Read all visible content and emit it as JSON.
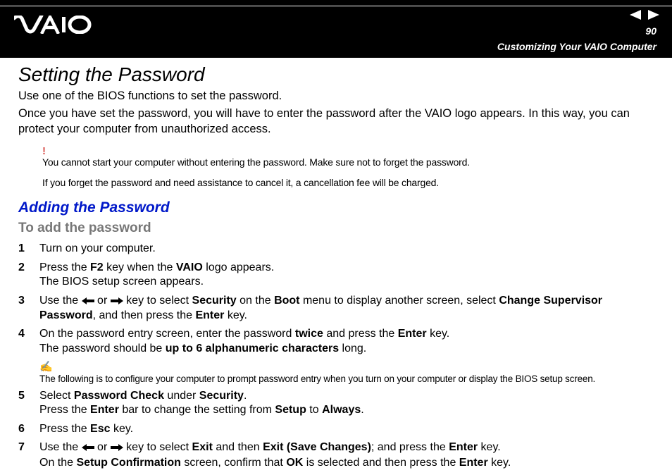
{
  "header": {
    "page_number": "90",
    "breadcrumb": "Customizing Your VAIO Computer"
  },
  "main": {
    "title": "Setting the Password",
    "intro1": "Use one of the BIOS functions to set the password.",
    "intro2": "Once you have set the password, you will have to enter the password after the VAIO logo appears. In this way, you can protect your computer from unauthorized access.",
    "warning_mark": "!",
    "warning_line1": "You cannot start your computer without entering the password. Make sure not to forget the password.",
    "warning_line2": "If you forget the password and need assistance to cancel it, a cancellation fee will be charged.",
    "subtitle": "Adding the Password",
    "subheading": "To add the password",
    "steps": {
      "s1": "Turn on your computer.",
      "s2_a": "Press the ",
      "s2_key": "F2",
      "s2_b": " key when the ",
      "s2_logo": "VAIO",
      "s2_c": " logo appears.",
      "s2_d": "The BIOS setup screen appears.",
      "s3_a": "Use the ",
      "s3_or": " or ",
      "s3_b": " key to select ",
      "s3_sec": "Security",
      "s3_c": " on the ",
      "s3_boot": "Boot",
      "s3_d": " menu to display another screen, select ",
      "s3_csp": "Change Supervisor Password",
      "s3_e": ", and then press the ",
      "s3_enter": "Enter",
      "s3_f": " key.",
      "s4_a": "On the password entry screen, enter the password ",
      "s4_twice": "twice",
      "s4_b": " and press the ",
      "s4_enter": "Enter",
      "s4_c": " key.",
      "s4_d": "The password should be ",
      "s4_chars": "up to 6 alphanumeric characters",
      "s4_e": " long.",
      "note_mark": "✍",
      "note_text": "The following is to configure your computer to prompt password entry when you turn on your computer or display the BIOS setup screen.",
      "s5_a": "Select ",
      "s5_pc": "Password Check",
      "s5_b": " under ",
      "s5_sec": "Security",
      "s5_c": ".",
      "s5_d": "Press the ",
      "s5_enter": "Enter",
      "s5_e": " bar to change the setting from ",
      "s5_setup": "Setup",
      "s5_f": " to ",
      "s5_always": "Always",
      "s5_g": ".",
      "s6_a": "Press the ",
      "s6_esc": "Esc",
      "s6_b": " key.",
      "s7_a": "Use the ",
      "s7_or": " or ",
      "s7_b": " key to select ",
      "s7_exit": "Exit",
      "s7_c": " and then ",
      "s7_esc": "Exit (Save Changes)",
      "s7_d": "; and press the ",
      "s7_enter": "Enter",
      "s7_e": " key.",
      "s7_f": "On the ",
      "s7_conf": "Setup Confirmation",
      "s7_g": " screen, confirm that ",
      "s7_ok": "OK",
      "s7_h": " is selected and then press the ",
      "s7_enter2": "Enter",
      "s7_i": " key."
    }
  }
}
